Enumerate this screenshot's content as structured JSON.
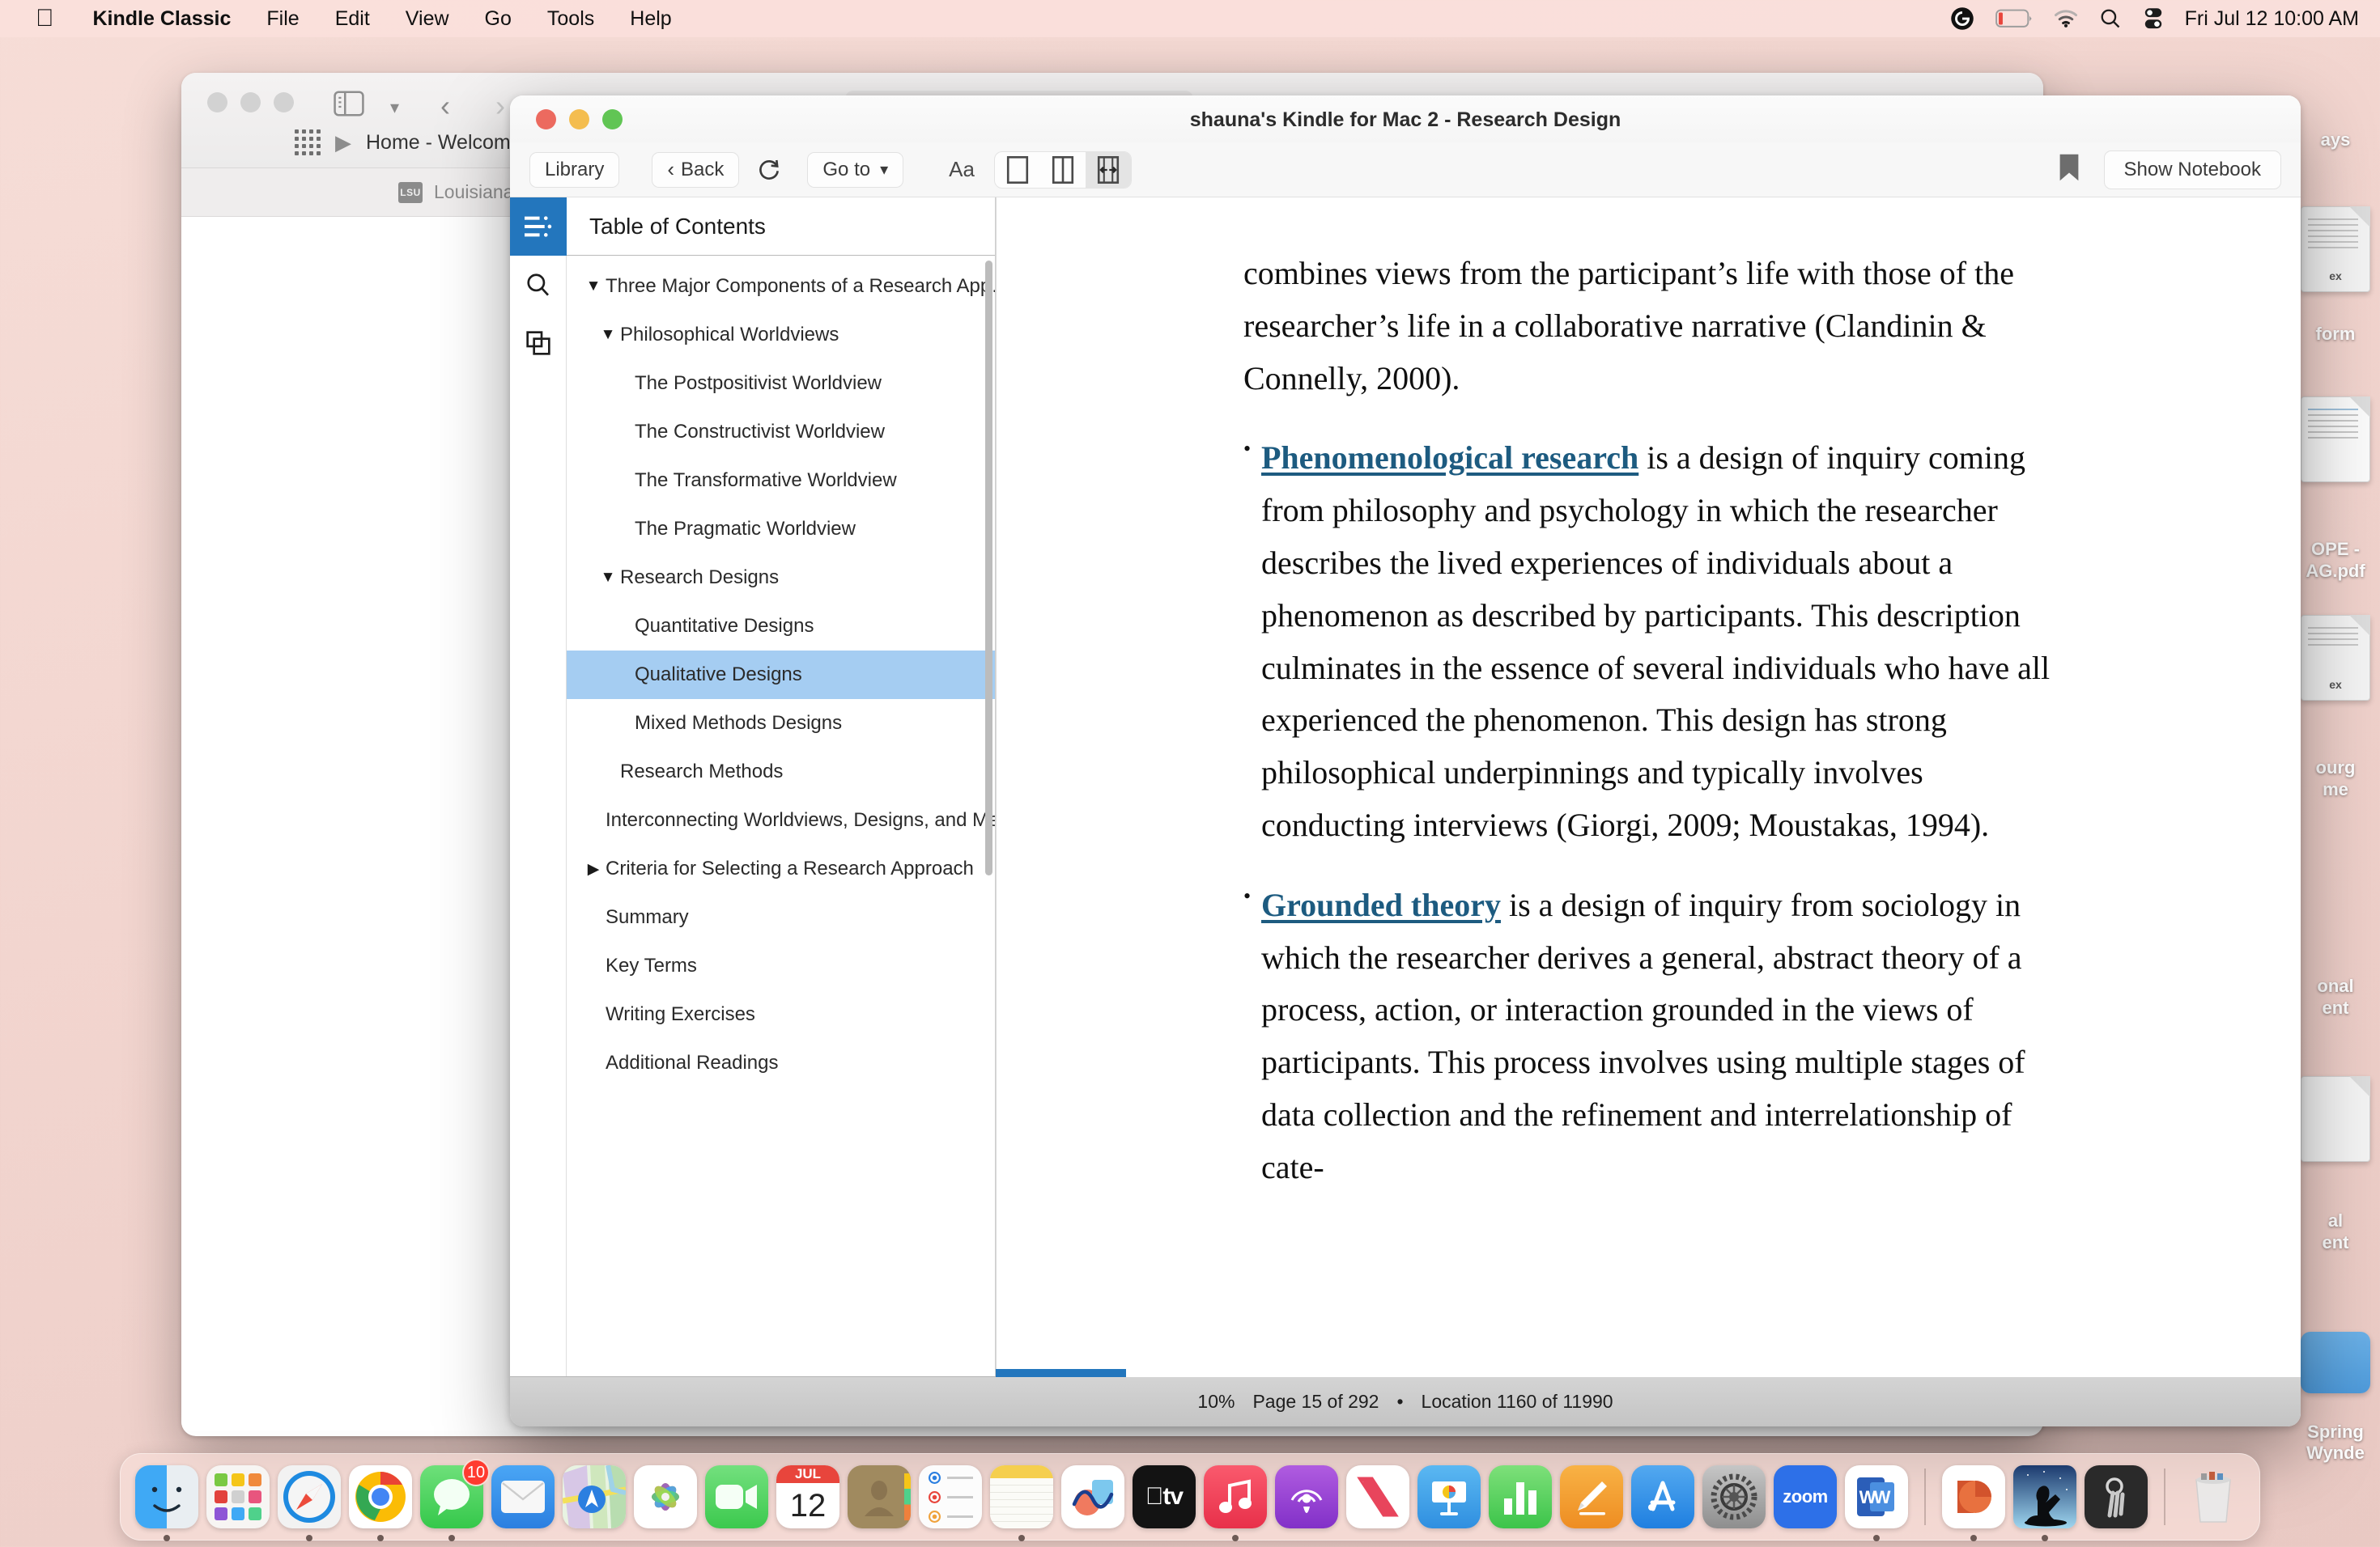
{
  "menubar": {
    "apple_icon": "apple-logo",
    "items": [
      "Kindle Classic",
      "File",
      "Edit",
      "View",
      "Go",
      "Tools",
      "Help"
    ],
    "status_icons": [
      "grammarly-icon",
      "battery-low-icon",
      "wifi-icon",
      "search-icon",
      "control-center-icon"
    ],
    "clock": "Fri Jul 12  10:00 AM"
  },
  "safari": {
    "tab_title": "Home - Welcome to Chart",
    "bookmark": "Louisiana State University",
    "bookmark_badge": "LSU"
  },
  "desktop_icons": [
    {
      "label": "ays",
      "type": "text"
    },
    {
      "label": "ex",
      "type": "doc"
    },
    {
      "label": "form",
      "type": "text"
    },
    {
      "label": "OPE -\nAG.pdf",
      "type": "text"
    },
    {
      "label": "ex",
      "type": "doc"
    },
    {
      "label": "ourg\nme",
      "type": "text"
    },
    {
      "label": "onal\nent",
      "type": "text"
    },
    {
      "label": "al\nent",
      "type": "doc-blank"
    },
    {
      "label": "Spring\nWynde",
      "type": "blue"
    }
  ],
  "kindle": {
    "window_title": "shauna's Kindle for Mac 2 - Research Design",
    "toolbar": {
      "library_label": "Library",
      "back_label": "Back",
      "sync_icon": "sync-icon",
      "goto_label": "Go to",
      "goto_caret": "⌄",
      "font_label": "Aa",
      "view_single_icon": "single-column-icon",
      "view_double_icon": "two-column-icon",
      "view_fit_icon": "fit-width-icon",
      "bookmark_icon": "bookmark-icon",
      "notebook_label": "Show Notebook"
    },
    "rail": [
      {
        "icon": "table-of-contents-icon",
        "active": true
      },
      {
        "icon": "search-icon",
        "active": false
      },
      {
        "icon": "flashcards-icon",
        "active": false
      }
    ],
    "toc": {
      "header": "Table of Contents",
      "items": [
        {
          "label": "Three Major Components of a Research App…",
          "caret": "▼",
          "level": 0,
          "selected": false
        },
        {
          "label": "Philosophical Worldviews",
          "caret": "▼",
          "level": 1,
          "selected": false
        },
        {
          "label": "The Postpositivist Worldview",
          "caret": "",
          "level": 2,
          "selected": false
        },
        {
          "label": "The Constructivist Worldview",
          "caret": "",
          "level": 2,
          "selected": false
        },
        {
          "label": "The Transformative Worldview",
          "caret": "",
          "level": 2,
          "selected": false
        },
        {
          "label": "The Pragmatic Worldview",
          "caret": "",
          "level": 2,
          "selected": false
        },
        {
          "label": "Research Designs",
          "caret": "▼",
          "level": 1,
          "selected": false
        },
        {
          "label": "Quantitative Designs",
          "caret": "",
          "level": 2,
          "selected": false
        },
        {
          "label": "Qualitative Designs",
          "caret": "",
          "level": 2,
          "selected": true
        },
        {
          "label": "Mixed Methods Designs",
          "caret": "",
          "level": 2,
          "selected": false
        },
        {
          "label": "Research Methods",
          "caret": "",
          "level": 1,
          "selected": false
        },
        {
          "label": "Interconnecting Worldviews, Designs, and Meth…",
          "caret": "",
          "level": 0,
          "selected": false
        },
        {
          "label": "Criteria for Selecting a Research Approach",
          "caret": "▶",
          "level": 0,
          "selected": false
        },
        {
          "label": "Summary",
          "caret": "",
          "level": 0,
          "selected": false
        },
        {
          "label": "Key Terms",
          "caret": "",
          "level": 0,
          "selected": false
        },
        {
          "label": "Writing Exercises",
          "caret": "",
          "level": 0,
          "selected": false
        },
        {
          "label": "Additional Readings",
          "caret": "",
          "level": 0,
          "selected": false
        }
      ]
    },
    "page": {
      "para1": "combines views from the participant’s life with those of the researcher’s life in a collaborative narrative (Clandinin & Connelly, 2000).",
      "bullet1_term": "Phenomenological research",
      "bullet1_rest": " is a design of inquiry coming from philosophy and psychology in which the researcher describes the lived experiences of individuals about a phenomenon as described by participants. This description culminates in the essence of several individuals who have all experienced the phenomenon. This design has strong philosophical underpinnings and typically involves conducting interviews (Giorgi, 2009; Moustakas, 1994).",
      "bullet2_term": "Grounded theory",
      "bullet2_rest": " is a design of inquiry from sociology in which the researcher derives a general, abstract theory of a process, action, or interaction grounded in the views of participants. This process involves using multiple stages of data collection and the refinement and interrelationship of cate-"
    },
    "status": {
      "percent": "10%",
      "page": "Page 15 of 292",
      "separator": "•",
      "location": "Location 1160 of 11990",
      "progress_value": 10,
      "accent_color": "#2376bd"
    }
  },
  "dock": {
    "apps": [
      {
        "name": "finder",
        "label": "Finder",
        "running": true
      },
      {
        "name": "launchpad",
        "label": "Launchpad",
        "running": false
      },
      {
        "name": "safari",
        "label": "Safari",
        "running": true
      },
      {
        "name": "chrome",
        "label": "Google Chrome",
        "running": true
      },
      {
        "name": "messages",
        "label": "Messages",
        "running": true,
        "badge": "10"
      },
      {
        "name": "mail",
        "label": "Mail",
        "running": false
      },
      {
        "name": "maps",
        "label": "Maps",
        "running": false
      },
      {
        "name": "photos",
        "label": "Photos",
        "running": false
      },
      {
        "name": "facetime",
        "label": "FaceTime",
        "running": false
      },
      {
        "name": "calendar",
        "label": "Calendar",
        "running": false,
        "month": "JUL",
        "day": "12"
      },
      {
        "name": "contacts",
        "label": "Contacts",
        "running": false
      },
      {
        "name": "reminders",
        "label": "Reminders",
        "running": false
      },
      {
        "name": "notes",
        "label": "Notes",
        "running": true
      },
      {
        "name": "freeform",
        "label": "Freeform",
        "running": false
      },
      {
        "name": "appletv",
        "label": "Apple TV",
        "running": false
      },
      {
        "name": "music",
        "label": "Music",
        "running": true
      },
      {
        "name": "podcasts",
        "label": "Podcasts",
        "running": false
      },
      {
        "name": "news",
        "label": "News",
        "running": false
      },
      {
        "name": "keynote",
        "label": "Keynote",
        "running": false
      },
      {
        "name": "numbers",
        "label": "Numbers",
        "running": false
      },
      {
        "name": "pages",
        "label": "Pages",
        "running": false
      },
      {
        "name": "appstore",
        "label": "App Store",
        "running": false
      },
      {
        "name": "settings",
        "label": "System Settings",
        "running": false
      },
      {
        "name": "zoom",
        "label": "zoom",
        "running": false
      },
      {
        "name": "word",
        "label": "Microsoft Word",
        "running": true
      },
      {
        "name": "separator1",
        "label": "",
        "running": false
      },
      {
        "name": "powerpoint",
        "label": "Microsoft PowerPoint",
        "running": true
      },
      {
        "name": "kindle",
        "label": "Kindle",
        "running": true
      },
      {
        "name": "keychain",
        "label": "Keychain Access",
        "running": false
      },
      {
        "name": "separator2",
        "label": "",
        "running": false
      },
      {
        "name": "trash",
        "label": "Trash",
        "running": false
      }
    ]
  }
}
